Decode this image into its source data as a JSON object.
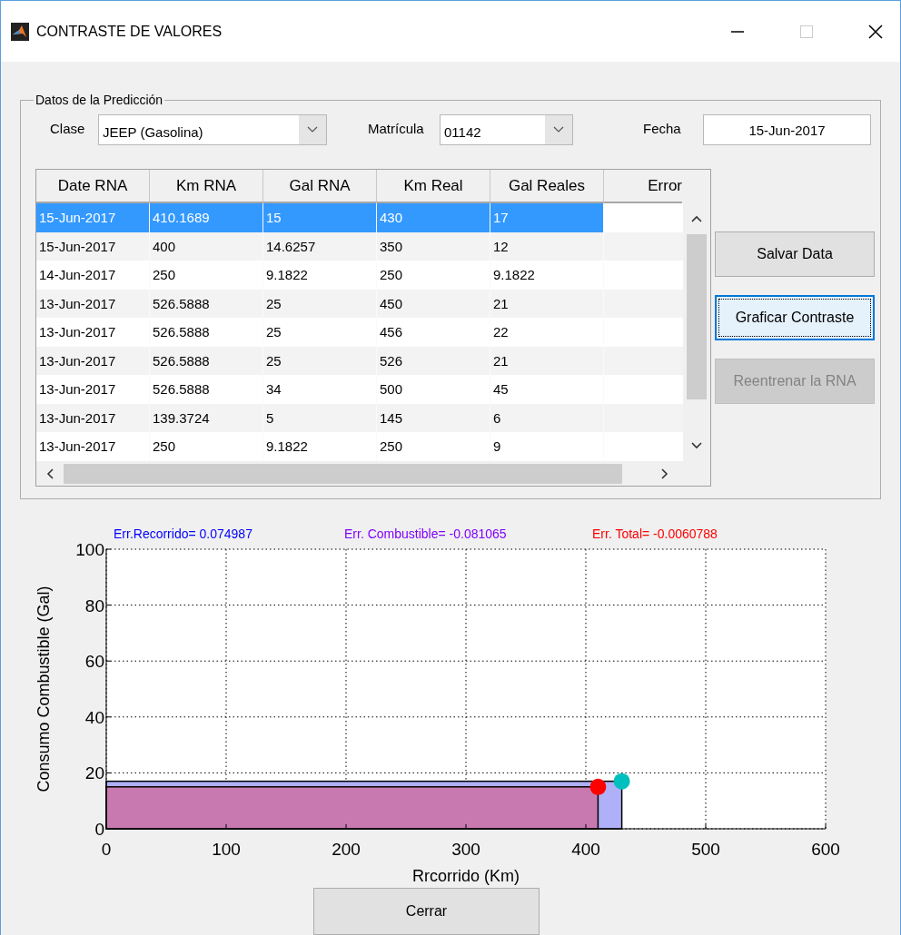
{
  "window": {
    "title": "CONTRASTE DE VALORES"
  },
  "prediction_panel": {
    "title": "Datos de la Predicción",
    "clase": {
      "label": "Clase",
      "value": "JEEP (Gasolina)"
    },
    "matricula": {
      "label": "Matrícula",
      "value": "01142"
    },
    "fecha": {
      "label": "Fecha",
      "value": "15-Jun-2017"
    },
    "table": {
      "columns": [
        "Date RNA",
        "Km RNA",
        "Gal RNA",
        "Km Real",
        "Gal Reales",
        "Error"
      ],
      "rows": [
        {
          "selected": true,
          "cells": [
            "15-Jun-2017",
            "410.1689",
            "15",
            "430",
            "17"
          ]
        },
        {
          "selected": false,
          "cells": [
            "15-Jun-2017",
            "400",
            "14.6257",
            "350",
            "12"
          ]
        },
        {
          "selected": false,
          "cells": [
            "14-Jun-2017",
            "250",
            "9.1822",
            "250",
            "9.1822"
          ]
        },
        {
          "selected": false,
          "cells": [
            "13-Jun-2017",
            "526.5888",
            "25",
            "450",
            "21"
          ]
        },
        {
          "selected": false,
          "cells": [
            "13-Jun-2017",
            "526.5888",
            "25",
            "456",
            "22"
          ]
        },
        {
          "selected": false,
          "cells": [
            "13-Jun-2017",
            "526.5888",
            "25",
            "526",
            "21"
          ]
        },
        {
          "selected": false,
          "cells": [
            "13-Jun-2017",
            "526.5888",
            "34",
            "500",
            "45"
          ]
        },
        {
          "selected": false,
          "cells": [
            "13-Jun-2017",
            "139.3724",
            "5",
            "145",
            "6"
          ]
        },
        {
          "selected": false,
          "cells": [
            "13-Jun-2017",
            "250",
            "9.1822",
            "250",
            "9"
          ]
        }
      ]
    },
    "buttons": [
      {
        "label": "Salvar Data",
        "focused": false,
        "disabled": false
      },
      {
        "label": "Graficar Contraste",
        "focused": true,
        "disabled": false
      },
      {
        "label": "Reentrenar la RNA",
        "focused": false,
        "disabled": true
      }
    ]
  },
  "error_labels": [
    {
      "text": "Err.Recorrido= 0.074987",
      "color": "#0000ff"
    },
    {
      "text": "Err. Combustible= -0.081065",
      "color": "#8000ff"
    },
    {
      "text": "Err. Total= -0.0060788",
      "color": "#ff0000"
    }
  ],
  "chart_data": {
    "type": "scatter",
    "xlabel": "Rrcorrido (Km)",
    "ylabel": "Consumo Combustible (Gal)",
    "xlim": [
      0,
      600
    ],
    "ylim": [
      0,
      100
    ],
    "xticks": [
      0,
      100,
      200,
      300,
      400,
      500,
      600
    ],
    "yticks": [
      0,
      20,
      40,
      60,
      80,
      100
    ],
    "grid": true,
    "x": [
      410.1689,
      430
    ],
    "series": [
      {
        "color": "#00bfbf",
        "values": [
          null,
          17
        ]
      },
      {
        "color": "#ff0000",
        "values": [
          15,
          null
        ]
      }
    ]
  },
  "close_button": {
    "label": "Cerrar"
  }
}
